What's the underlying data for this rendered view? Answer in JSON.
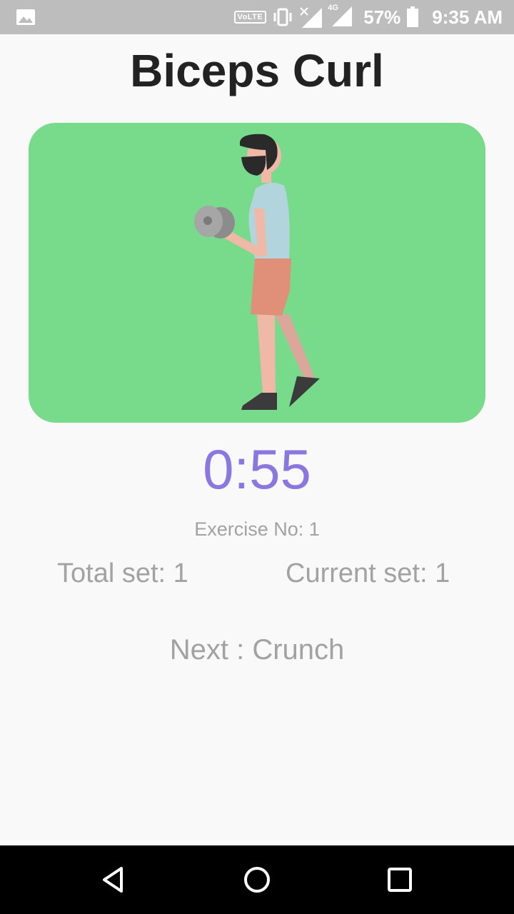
{
  "status_bar": {
    "network_badge": "VoLTE",
    "network_type": "4G",
    "battery": "57%",
    "time": "9:35 AM",
    "icons": [
      "gallery-icon",
      "vibrate-icon",
      "signal-icon",
      "signal-4g-icon",
      "battery-icon"
    ]
  },
  "exercise": {
    "title": "Biceps Curl",
    "image_bg": "#78db8b",
    "timer": "0:55",
    "timer_color": "#8a78e0",
    "exercise_no": "Exercise No: 1",
    "total_set": "Total set: 1",
    "current_set": "Current set: 1",
    "next": "Next : Crunch"
  },
  "nav_bar": {
    "icons": [
      "back-icon",
      "home-icon",
      "recents-icon"
    ]
  }
}
